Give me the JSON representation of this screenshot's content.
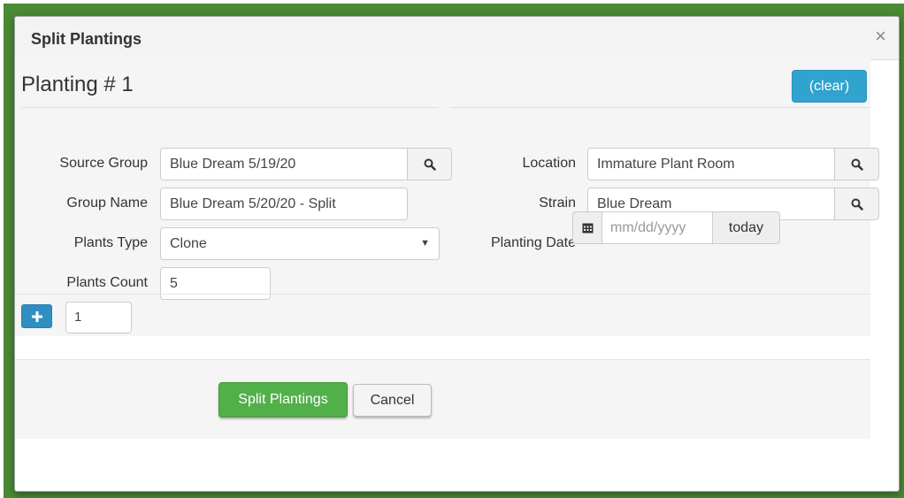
{
  "dialog": {
    "title": "Split Plantings",
    "close_glyph": "×"
  },
  "planting": {
    "heading": "Planting # 1",
    "clear_label": "(clear)"
  },
  "form": {
    "source_group": {
      "label": "Source Group",
      "value": "Blue Dream 5/19/20"
    },
    "group_name": {
      "label": "Group Name",
      "value": "Blue Dream 5/20/20 - Split"
    },
    "plants_type": {
      "label": "Plants Type",
      "value": "Clone"
    },
    "plants_count": {
      "label": "Plants Count",
      "value": "5"
    },
    "location": {
      "label": "Location",
      "value": "Immature Plant Room"
    },
    "strain": {
      "label": "Strain",
      "value": "Blue Dream"
    },
    "planting_date": {
      "label": "Planting Date",
      "placeholder": "mm/dd/yyyy",
      "today_label": "today"
    }
  },
  "add_row": {
    "count_value": "1"
  },
  "footer": {
    "submit_label": "Split Plantings",
    "cancel_label": "Cancel"
  },
  "icons": {
    "search": "search-icon",
    "calendar": "calendar-icon",
    "plus": "plus-icon",
    "dropdown": "chevron-down-icon"
  },
  "colors": {
    "backdrop": "#4a8a35",
    "primary_blue": "#31a3cf",
    "success_green": "#52b04a"
  }
}
